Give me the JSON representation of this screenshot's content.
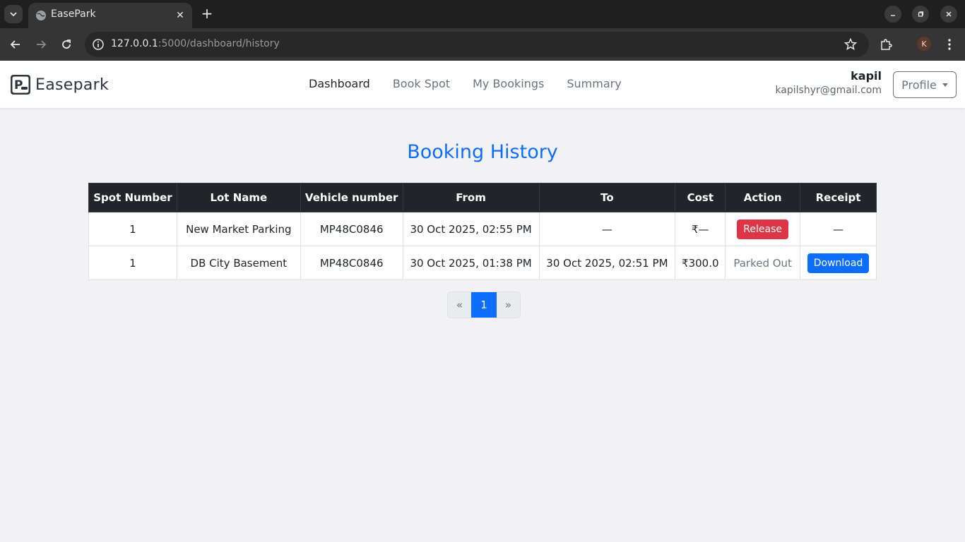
{
  "browser": {
    "tab_title": "EasePark",
    "url_host": "127.0.0.1",
    "url_rest": ":5000/dashboard/history",
    "profile_initial": "K"
  },
  "nav": {
    "brand": "Easepark",
    "links": [
      "Dashboard",
      "Book Spot",
      "My Bookings",
      "Summary"
    ],
    "active": "Dashboard",
    "user_name": "kapil",
    "user_email": "kapilshyr@gmail.com",
    "profile_label": "Profile"
  },
  "page": {
    "title": "Booking History"
  },
  "table": {
    "headers": [
      "Spot Number",
      "Lot Name",
      "Vehicle number",
      "From",
      "To",
      "Cost",
      "Action",
      "Receipt"
    ],
    "rows": [
      {
        "spot": "1",
        "lot": "New Market Parking",
        "vehicle": "MP48C0846",
        "from": "30 Oct 2025, 02:55 PM",
        "to": "—",
        "cost": "₹—",
        "action": "Release",
        "receipt": "—"
      },
      {
        "spot": "1",
        "lot": "DB City Basement",
        "vehicle": "MP48C0846",
        "from": "30 Oct 2025, 01:38 PM",
        "to": "30 Oct 2025, 02:51 PM",
        "cost": "₹300.0",
        "action": "Parked Out",
        "receipt": "Download"
      }
    ]
  },
  "pagination": {
    "prev": "«",
    "current": "1",
    "next": "»"
  },
  "colors": {
    "primary": "#0d6efd",
    "danger": "#dc3545",
    "table_header": "#212529"
  }
}
